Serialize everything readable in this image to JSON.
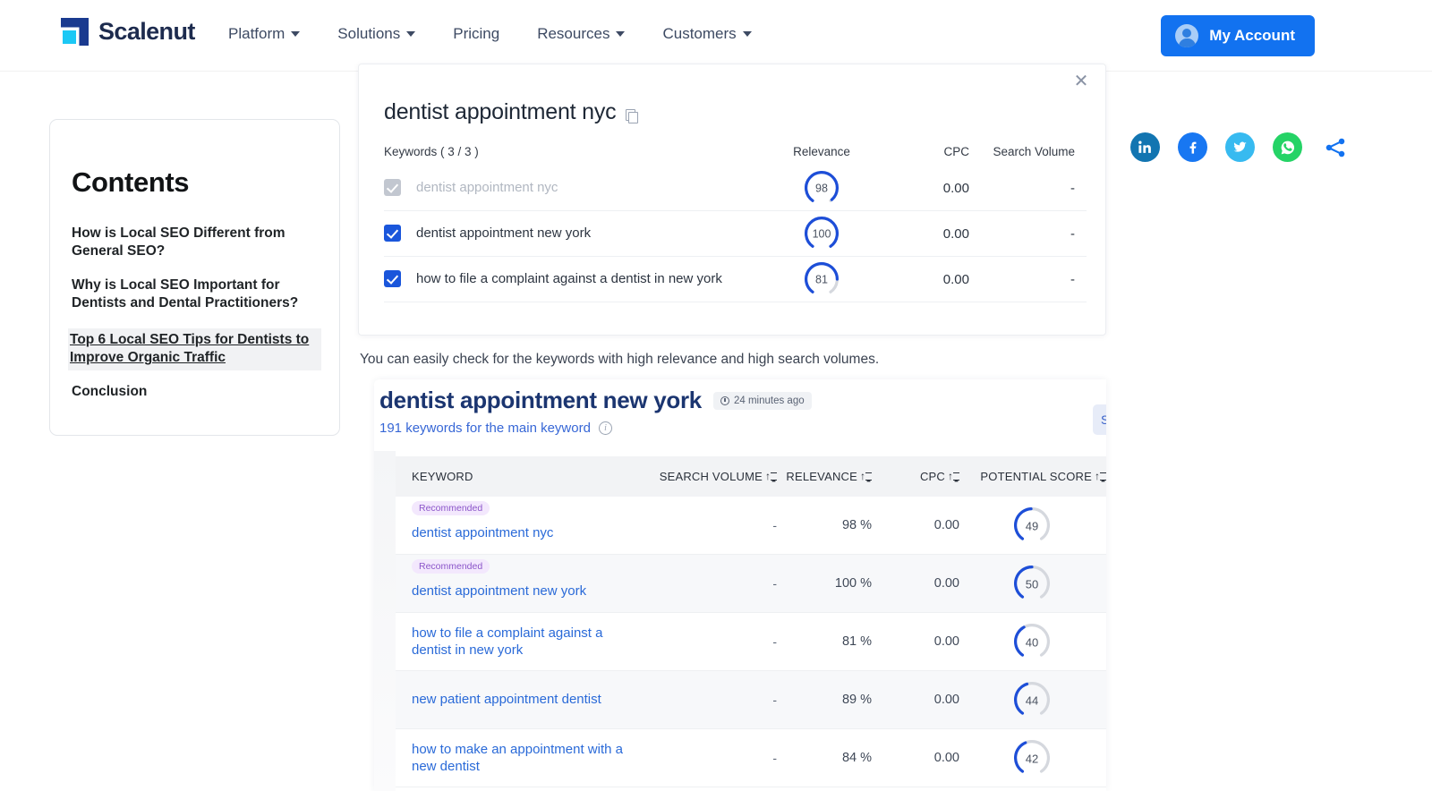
{
  "nav": {
    "logo_text": "Scalenut",
    "links": [
      {
        "label": "Platform",
        "caret": true
      },
      {
        "label": "Solutions",
        "caret": true
      },
      {
        "label": "Pricing",
        "caret": false
      },
      {
        "label": "Resources",
        "caret": true
      },
      {
        "label": "Customers",
        "caret": true
      }
    ],
    "account_label": "My Account"
  },
  "contents": {
    "title": "Contents",
    "items": [
      {
        "label": "How is Local SEO Different from General SEO?",
        "active": false
      },
      {
        "label": "Why is Local SEO Important for Dentists and Dental Practitioners?",
        "active": false
      },
      {
        "label": "Top 6 Local SEO Tips for Dentists to Improve Organic Traffic",
        "active": true
      },
      {
        "label": "Conclusion",
        "active": false
      }
    ]
  },
  "socials": [
    {
      "name": "linkedin-icon",
      "label": "in"
    },
    {
      "name": "facebook-icon",
      "label": "f"
    },
    {
      "name": "twitter-icon",
      "label": "t"
    },
    {
      "name": "whatsapp-icon",
      "label": "w"
    },
    {
      "name": "share-icon",
      "label": "share"
    }
  ],
  "keyword_panel": {
    "title": "dentist appointment nyc",
    "close_label": "✕",
    "columns": {
      "keywords": "Keywords  ( 3 / 3 )",
      "relevance": "Relevance",
      "cpc": "CPC",
      "search_volume": "Search Volume"
    },
    "rows": [
      {
        "keyword": "dentist appointment nyc",
        "checked": true,
        "disabled": true,
        "relevance": "98",
        "relevance_pct": 98,
        "cpc": "0.00",
        "volume": "-"
      },
      {
        "keyword": "dentist appointment new york",
        "checked": true,
        "disabled": false,
        "relevance": "100",
        "relevance_pct": 100,
        "cpc": "0.00",
        "volume": "-"
      },
      {
        "keyword": "how to file a complaint against a dentist in new york",
        "checked": true,
        "disabled": false,
        "relevance": "81",
        "relevance_pct": 81,
        "cpc": "0.00",
        "volume": "-"
      }
    ]
  },
  "body_note": "You can easily check for the keywords with high relevance and high search volumes.",
  "results": {
    "heading": "dentist appointment new york",
    "time_chip": "24 minutes ago",
    "subtitle": "191 keywords for the main keyword",
    "side_button": "S",
    "columns": {
      "keyword": "KEYWORD",
      "search_volume": "SEARCH VOLUME",
      "relevance": "RELEVANCE",
      "cpc": "CPC",
      "potential_score": "POTENTIAL SCORE"
    },
    "badge_label": "Recommended",
    "rows": [
      {
        "keyword": "dentist appointment nyc",
        "badge": true,
        "search_volume": "-",
        "relevance": "98 %",
        "cpc": "0.00",
        "score": "49",
        "score_pct": 49,
        "alt": false
      },
      {
        "keyword": "dentist appointment new york",
        "badge": true,
        "search_volume": "-",
        "relevance": "100 %",
        "cpc": "0.00",
        "score": "50",
        "score_pct": 50,
        "alt": true
      },
      {
        "keyword": "how to file a complaint against a dentist in new york",
        "badge": false,
        "search_volume": "-",
        "relevance": "81 %",
        "cpc": "0.00",
        "score": "40",
        "score_pct": 40,
        "alt": false
      },
      {
        "keyword": "new patient appointment dentist",
        "badge": false,
        "search_volume": "-",
        "relevance": "89 %",
        "cpc": "0.00",
        "score": "44",
        "score_pct": 44,
        "alt": true
      },
      {
        "keyword": "how to make an appointment with a new dentist",
        "badge": false,
        "search_volume": "-",
        "relevance": "84 %",
        "cpc": "0.00",
        "score": "42",
        "score_pct": 42,
        "alt": false
      }
    ]
  },
  "colors": {
    "brand_blue": "#1272f0",
    "logo_dark": "#1a3a8f",
    "logo_cyan": "#1cc8f5",
    "gauge_blue": "#1d4ed8",
    "gauge_track": "#d5d8de",
    "link_blue": "#2a6ad8",
    "badge_bg": "#f3e8fd",
    "badge_text": "#8b55c9"
  }
}
